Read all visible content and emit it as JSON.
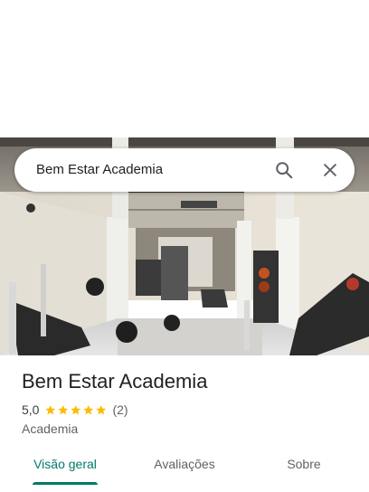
{
  "search": {
    "query": "Bem Estar Academia"
  },
  "place": {
    "name": "Bem Estar Academia",
    "rating": "5,0",
    "stars": 5,
    "review_count": "(2)",
    "category": "Academia",
    "star_color": "#fbbc04"
  },
  "tabs": [
    {
      "label": "Visão geral",
      "active": true
    },
    {
      "label": "Avaliações",
      "active": false
    },
    {
      "label": "Sobre",
      "active": false
    }
  ],
  "colors": {
    "accent": "#00796b",
    "text_primary": "#202124",
    "text_secondary": "#5f6368"
  },
  "icons": {
    "search": "search-icon",
    "close": "close-icon",
    "star": "star-icon"
  }
}
